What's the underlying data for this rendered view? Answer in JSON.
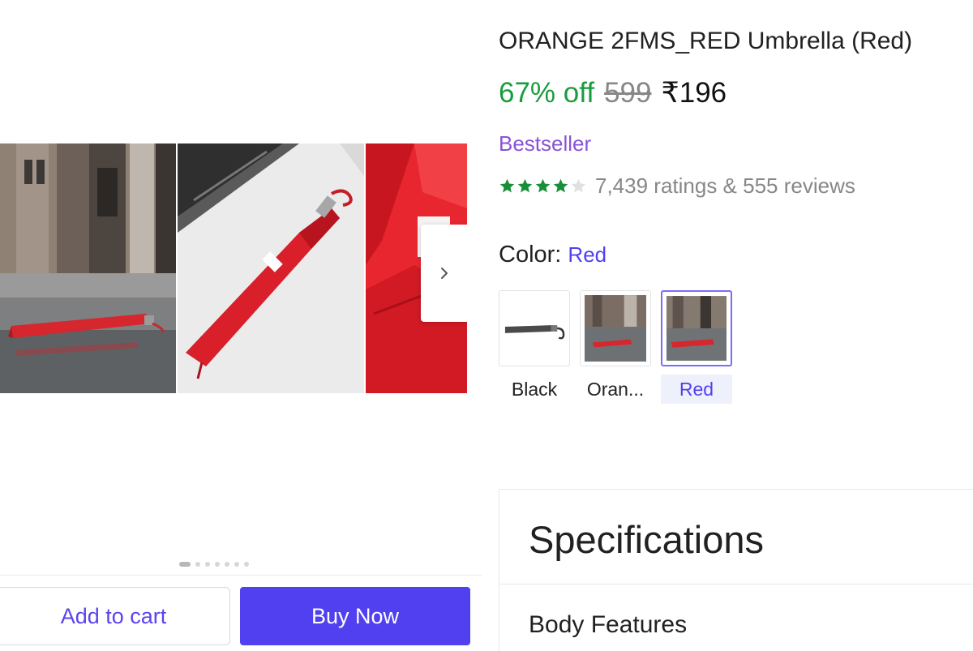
{
  "product": {
    "title": "ORANGE 2FMS_RED Umbrella (Red)",
    "discount": "67% off",
    "mrp": "599",
    "price": "₹196",
    "badge": "Bestseller",
    "rating": 4,
    "rating_text": "7,439 ratings & 555 reviews"
  },
  "color": {
    "label": "Color:",
    "selected": "Red",
    "options": [
      {
        "label": "Black",
        "selected": false
      },
      {
        "label": "Oran...",
        "selected": false
      },
      {
        "label": "Red",
        "selected": true
      }
    ]
  },
  "gallery": {
    "image_count": 7,
    "active_index": 0,
    "next_icon": "chevron-right-icon"
  },
  "actions": {
    "add_to_cart": "Add to cart",
    "buy_now": "Buy Now"
  },
  "specifications": {
    "title": "Specifications",
    "section": "Body Features"
  },
  "colors": {
    "accent": "#5140f0",
    "discount_green": "#1a9c3e",
    "badge_purple": "#8a52d8",
    "star_green": "#1a8f3a"
  }
}
